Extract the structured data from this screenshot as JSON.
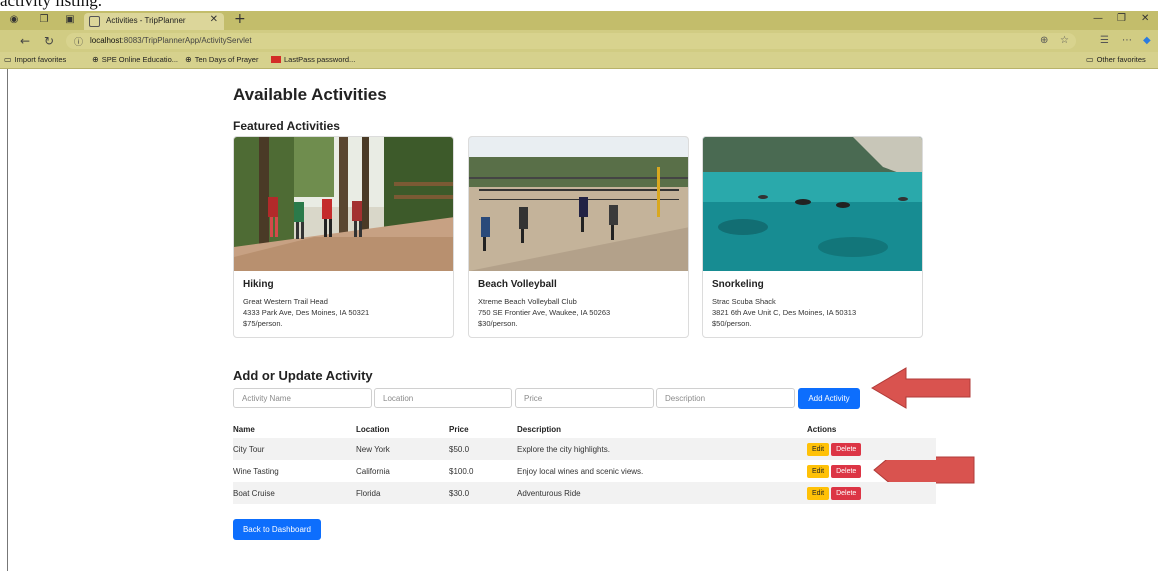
{
  "caption_fragment": "activity listing.",
  "browser": {
    "tab_title": "Activities - TripPlanner",
    "new_tab": "+",
    "url_host": "localhost",
    "url_path": ":8083/TripPlannerApp/ActivityServlet",
    "favorites": [
      {
        "label": "Import favorites",
        "icon": "folder-icon"
      },
      {
        "label": "SPE Online Educatio...",
        "icon": "globe-icon"
      },
      {
        "label": "Ten Days of Prayer",
        "icon": "globe-icon"
      },
      {
        "label": "LastPass password...",
        "icon": "lastpass-icon"
      }
    ],
    "other_favorites": "Other favorites"
  },
  "page": {
    "title": "Available Activities",
    "featured_title": "Featured Activities",
    "cards": [
      {
        "name": "Hiking",
        "venue": "Great Western Trail Head",
        "address": "4333 Park Ave, Des Moines, IA 50321",
        "price": "$75/person."
      },
      {
        "name": "Beach Volleyball",
        "venue": "Xtreme Beach Volleyball Club",
        "address": "750 SE Frontier Ave, Waukee, IA 50263",
        "price": "$30/person."
      },
      {
        "name": "Snorkeling",
        "venue": "Strac Scuba Shack",
        "address": "3821 6th Ave Unit C, Des Moines, IA 50313",
        "price": "$50/person."
      }
    ],
    "form": {
      "title": "Add or Update Activity",
      "name_placeholder": "Activity Name",
      "location_placeholder": "Location",
      "price_placeholder": "Price",
      "description_placeholder": "Description",
      "submit_label": "Add Activity"
    },
    "table": {
      "headers": [
        "Name",
        "Location",
        "Price",
        "Description",
        "Actions"
      ],
      "rows": [
        {
          "name": "City Tour",
          "location": "New York",
          "price": "$50.0",
          "description": "Explore the city highlights."
        },
        {
          "name": "Wine Tasting",
          "location": "California",
          "price": "$100.0",
          "description": "Enjoy local wines and scenic views."
        },
        {
          "name": "Boat Cruise",
          "location": "Florida",
          "price": "$30.0",
          "description": "Adventurous Ride"
        }
      ],
      "edit_label": "Edit",
      "delete_label": "Delete"
    },
    "back_label": "Back to Dashboard"
  },
  "colors": {
    "primary": "#0d6efd",
    "edit": "#ffc107",
    "delete": "#dc3545",
    "arrow": "#d9534f",
    "titlebar": "#c3bd6b"
  }
}
